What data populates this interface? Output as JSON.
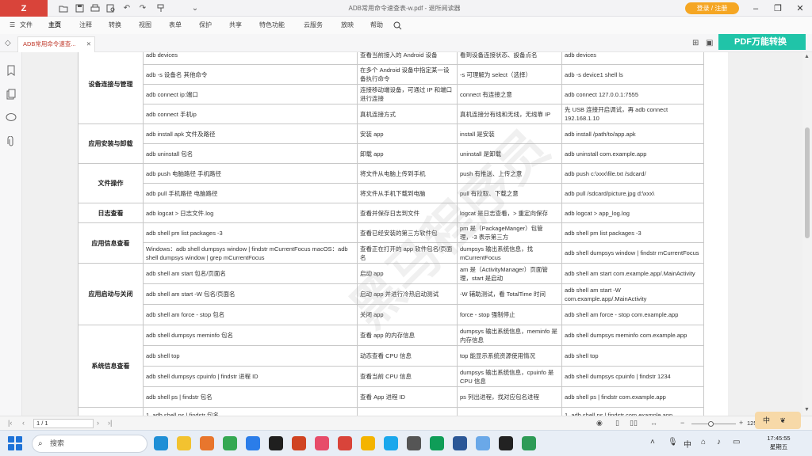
{
  "window": {
    "app_logo": "Z",
    "title": "ADB常用命令速查表-w.pdf - 退所阅读器",
    "login_button": "登录 / 注册",
    "quick_access_icons": [
      "folder-icon",
      "save-icon",
      "print-icon",
      "print-preview-icon",
      "undo-icon",
      "redo-icon",
      "format-brush-icon",
      "dropdown-icon"
    ]
  },
  "menu": {
    "items": [
      "文件",
      "主页",
      "注释",
      "转换",
      "视图",
      "表单",
      "保护",
      "共享",
      "特色功能",
      "云服务",
      "放映",
      "帮助"
    ],
    "active": "主页"
  },
  "tab": {
    "document_tab_label": "ADB常用命令速查...",
    "pdf_convert_button": "PDF万能转换"
  },
  "table": {
    "rows": [
      {
        "cat": "设备连接与管理",
        "span": 4,
        "cmd": "adb devices",
        "desc": "查看当前接入的 Android 设备",
        "note": "看到设备连接状态、設备点名",
        "example": "adb devices"
      },
      {
        "cmd": "adb -s 设备名 其他命令",
        "desc": "在多个 Android 设备中指定某一设备执行命令",
        "note": "-s 可理解为 select（选择）",
        "example": "adb -s device1 shell ls"
      },
      {
        "cmd": "adb connect ip:端口",
        "desc": "连接移动端设备，可通过 IP 和端口进行连接",
        "note": "connect 有连接之意",
        "example": "adb connect 127.0.0.1:7555"
      },
      {
        "cmd": "adb connect 手机ip",
        "desc": "真机连接方式",
        "note": "真机连接分有线和无线，无线靠 IP",
        "example": "先 USB 连接开启调试，再 adb connect 192.168.1.10"
      },
      {
        "cat": "应用安装与卸载",
        "span": 2,
        "cmd": "adb install apk 文件及路径",
        "desc": "安装 app",
        "note": "install 是安装",
        "example": "adb install /path/to/app.apk"
      },
      {
        "cmd": "adb uninstall 包名",
        "desc": "卸载 app",
        "note": "uninstall 是卸载",
        "example": "adb uninstall com.example.app"
      },
      {
        "cat": "文件操作",
        "span": 2,
        "cmd": "adb push 电脑路径 手机路径",
        "desc": "将文件从电脑上传到手机",
        "note": "push 有推送、上传之意",
        "example": "adb push c:\\xxx\\file.txt /sdcard/"
      },
      {
        "cmd": "adb pull 手机路径 电脑路径",
        "desc": "将文件从手机下载到电脑",
        "note": "pull 有拉取、下载之意",
        "example": "adb pull /sdcard/picture.jpg d:\\xxx\\"
      },
      {
        "cat": "日志查看",
        "span": 1,
        "cmd": "adb logcat > 日志文件.log",
        "desc": "查看并保存日志到文件",
        "note": "logcat 是日志查看，> 重定向保存",
        "example": "adb logcat > app_log.log"
      },
      {
        "cat": "应用信息查看",
        "span": 2,
        "cmd": "adb shell pm list packages -3",
        "desc": "查看已经安装的第三方软件包",
        "note": "pm 是（PackageManger）包管理，-3 表示第三方",
        "example": "adb shell pm list packages -3"
      },
      {
        "cmd": "Windows：adb shell dumpsys window | findstr mCurrentFocus macOS：adb shell dumpsys window | grep mCurrentFocus",
        "desc": "查看正在打开的 app 软件包名/页面名",
        "note": "dumpsys 输出系统信息，找 mCurrentFocus",
        "example": "adb shell dumpsys window | findstr mCurrentFocus"
      },
      {
        "cat": "应用启动与关闭",
        "span": 3,
        "cmd": "adb shell am start 包名/页面名",
        "desc": "启动 app",
        "note": "am 是（ActivityManager）页面管理，start 是启动",
        "example": "adb shell am start com.example.app/.MainActivity"
      },
      {
        "cmd": "adb shell am start -W 包名/页面名",
        "desc": "启动 app 并进行冷热启动测试",
        "note": "-W 辅助测试，看 TotalTime 时间",
        "example": "adb shell am start -W com.example.app/.MainActivity"
      },
      {
        "cmd": "adb shell am force - stop 包名",
        "desc": "关闭 app",
        "note": "force - stop 强制停止",
        "example": "adb shell am force - stop com.example.app"
      },
      {
        "cat": "系统信息查看",
        "span": 4,
        "cmd": "adb shell dumpsys meminfo 包名",
        "desc": "查看 app 的内存信息",
        "note": "dumpsys 输出系统信息，meminfo 是内存信息",
        "example": "adb shell dumpsys meminfo com.example.app"
      },
      {
        "cmd": "adb shell top",
        "desc": "动态查看 CPU 信息",
        "note": "top 能显示系统资源使用情况",
        "example": "adb shell top"
      },
      {
        "cmd": "adb shell dumpsys cpuinfo | findstr 进程 ID",
        "desc": "查看当前 CPU 信息",
        "note": "dumpsys 输出系统信息，cpuinfo 是 CPU 信息",
        "example": "adb shell dumpsys cpuinfo | findstr 1234"
      },
      {
        "cmd": "adb shell ps | findstr 包名",
        "desc": "查看 App 进程 ID",
        "note": "ps 列出进程，找对应包名进程",
        "example": "adb shell ps | findstr com.example.app"
      },
      {
        "cat": "",
        "span": 1,
        "cmd": "1. adb shell ps | findstr 包名",
        "desc": "",
        "note": "",
        "example": "1. adb shell ps | findstr com.example.app"
      }
    ]
  },
  "watermark": "黑马程序员",
  "statusbar": {
    "page_indicator": "1 / 1",
    "zoom": "125"
  },
  "ime": {
    "label": "中"
  },
  "taskbar": {
    "search_placeholder": "搜索",
    "clock_time": "17:45:55",
    "clock_day": "星期五",
    "apps": [
      {
        "name": "edge-icon",
        "color": "#1f8fd6"
      },
      {
        "name": "file-explorer-icon",
        "color": "#f2c230"
      },
      {
        "name": "firefox-icon",
        "color": "#e8762d"
      },
      {
        "name": "chrome-icon",
        "color": "#34a853"
      },
      {
        "name": "chat-app-icon",
        "color": "#2b7de9"
      },
      {
        "name": "pycharm-icon",
        "color": "#1f1f1f"
      },
      {
        "name": "powerpoint-icon",
        "color": "#d04423"
      },
      {
        "name": "snip-tool-icon",
        "color": "#e74c6a"
      },
      {
        "name": "pdf-reader-icon",
        "color": "#d9443a"
      },
      {
        "name": "notes-icon",
        "color": "#f4b400"
      },
      {
        "name": "app-m-icon",
        "color": "#1aa7ec"
      },
      {
        "name": "clock-app-icon",
        "color": "#555555"
      },
      {
        "name": "media-icon",
        "color": "#0f9d58"
      },
      {
        "name": "word-icon",
        "color": "#2b5797"
      },
      {
        "name": "gallery-icon",
        "color": "#6aa8e8"
      },
      {
        "name": "terminal-icon",
        "color": "#222222"
      },
      {
        "name": "clipboard-icon",
        "color": "#2e9b57"
      }
    ]
  }
}
